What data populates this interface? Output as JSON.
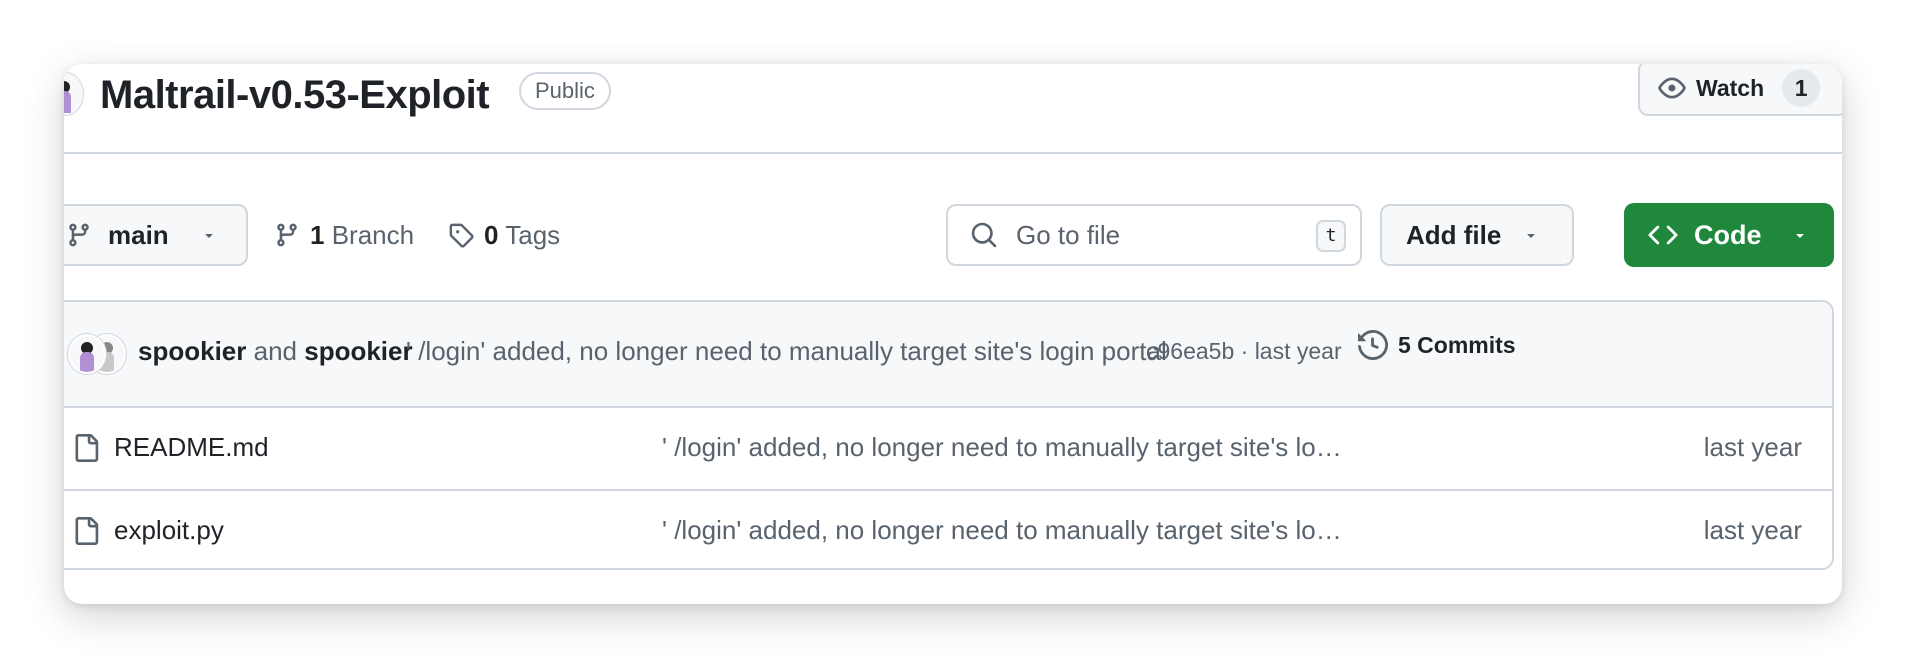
{
  "repo": {
    "name": "Maltrail-v0.53-Exploit",
    "visibility": "Public"
  },
  "watch": {
    "label": "Watch",
    "count": "1"
  },
  "toolbar": {
    "branch": "main",
    "branch_count": "1",
    "branch_label": "Branch",
    "tag_count": "0",
    "tag_label": "Tags",
    "goto_placeholder": "Go to file",
    "goto_kbd": "t",
    "add_file_label": "Add file",
    "code_label": "Code"
  },
  "latest_commit": {
    "author1": "spookier",
    "and": "and",
    "author2": "spookier",
    "message": "' /login' added, no longer need to manually target site's login portal",
    "sha_time": "c96ea5b · last year",
    "commits_label": "5 Commits"
  },
  "files": [
    {
      "name": "README.md",
      "message": "' /login' added, no longer need to manually target site's lo…",
      "date": "last year"
    },
    {
      "name": "exploit.py",
      "message": "' /login' added, no longer need to manually target site's lo…",
      "date": "last year"
    }
  ],
  "colors": {
    "code_button": "#1f883d",
    "border": "#d0d7de",
    "muted_text": "#59636e"
  }
}
